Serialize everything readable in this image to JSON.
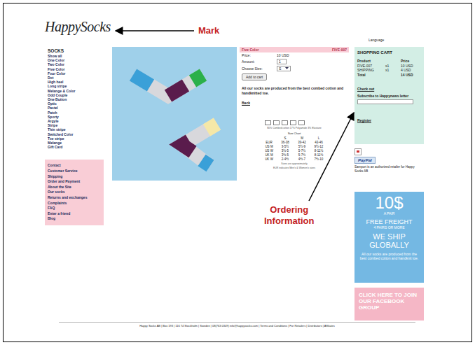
{
  "annotations": {
    "mark": "Mark",
    "ordering": [
      "Ordering",
      "Information"
    ]
  },
  "header": {
    "logo": "HappySocks",
    "language": "Language"
  },
  "sidebar": {
    "heading": "SOCKS",
    "items": [
      "Show all",
      "One Color",
      "Two Color",
      "Five Color",
      "Four Color",
      "Dot",
      "High heel",
      "Long stripe",
      "Melange & Color",
      "Odd Couple",
      "One Button",
      "Optic",
      "Pastel",
      "Patch",
      "Sporty",
      "Argyle",
      "Stripe",
      "Thin stripe",
      "Switched Color",
      "Toe stripe",
      "Melange",
      "Gift Card"
    ],
    "links": [
      "Contact",
      "Customer Service",
      "Shipping",
      "Order and Payment",
      "About the Site",
      "Our socks",
      "Returns and exchanges",
      "Complaints",
      "FAQ",
      "Enter a friend",
      "Blog"
    ]
  },
  "product": {
    "name": "Five Color",
    "code": "FIVE-007",
    "price_label": "Price:",
    "price": "10 USD",
    "amount_label": "Amount:",
    "amount": "1",
    "size_label": "Choose Size:",
    "size": "S",
    "add_button": "Add to cart",
    "description": "All our socks are produced from the best combed cotton and handknitted toe.",
    "back": "Back",
    "material": "80% Combed cotton 17% Polyamide 3% Elastane",
    "size_chart": {
      "title": "Size Chart",
      "columns": [
        "",
        "S",
        "M",
        "L"
      ],
      "rows": [
        [
          "EUR",
          "36-38",
          "39-42",
          "43-46"
        ],
        [
          "US M",
          "3-5½",
          "5½-9",
          "9½-12"
        ],
        [
          "US W",
          "3½-5",
          "5-7½",
          "8-11½"
        ],
        [
          "UK M",
          "3½-5",
          "5-7½",
          "8-11½"
        ],
        [
          "UK W",
          "2-4½",
          "4½-7",
          "7½-10"
        ]
      ]
    },
    "notes": [
      "Sizes are approximately",
      "EUR indicates Men's & Women's sizes"
    ]
  },
  "cart": {
    "title": "SHOPPING CART",
    "columns": [
      "Product",
      "Price"
    ],
    "rows": [
      {
        "product": "FIVE-007",
        "qty": "x1",
        "price": "10 USD"
      },
      {
        "product": "SHIPPING",
        "qty": "x1",
        "price": "4 USD"
      }
    ],
    "total_label": "Total",
    "total": "14 USD",
    "checkout": "Check out",
    "subscribe": "Subscribe to Happynews letter",
    "register": "Register"
  },
  "paypal": {
    "badge": "PayPal",
    "text": "Samport is an authorized retailer for Happy Socks AB"
  },
  "promo": {
    "price": "10$",
    "unit": "A PAIR",
    "freight": "FREE FREIGHT",
    "freight_note": "4 PAIRS OR MORE",
    "ship": "WE SHIP GLOBALLY",
    "text": "All our socks are produced from the best combed cotton and handknit toe."
  },
  "facebook": "CLICK HERE TO JOIN OUR FACEBOOK GROUP",
  "footer": "Happy Socks AB | Box 193 | 116 74 Stockholm | Sweden | 08(763 0349) info@happysocks.com | Terms and Conditions | For Retailers | Distributors | Affiliates"
}
